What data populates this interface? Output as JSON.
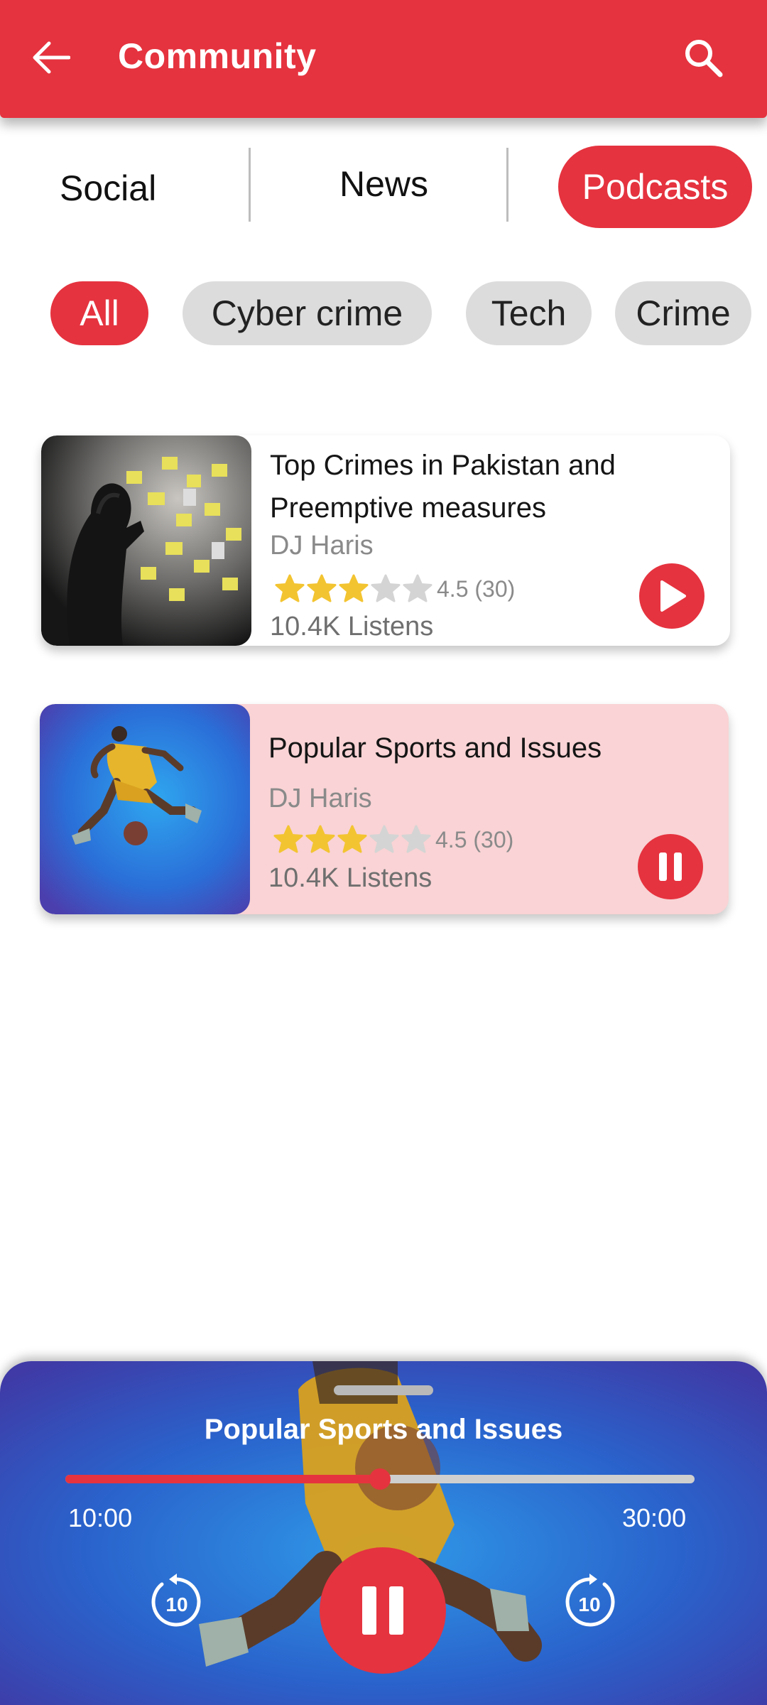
{
  "header": {
    "title": "Community",
    "back_icon": "arrow-left-icon",
    "search_icon": "search-icon",
    "background": "#e5333f"
  },
  "tabs": [
    {
      "label": "Social",
      "active": false
    },
    {
      "label": "News",
      "active": false
    },
    {
      "label": "Podcasts",
      "active": true
    }
  ],
  "filters": [
    {
      "label": "All",
      "active": true
    },
    {
      "label": "Cyber crime",
      "active": false
    },
    {
      "label": "Tech",
      "active": false
    },
    {
      "label": "Crime",
      "active": false
    }
  ],
  "podcasts": [
    {
      "title": "Top Crimes in Pakistan and Preemptive measures",
      "author": "DJ Haris",
      "rating_stars": 3,
      "rating_text": "4.5 (30)",
      "listens": "10.4K Listens",
      "action_icon": "play-icon",
      "playing": false
    },
    {
      "title": "Popular Sports and Issues",
      "author": "DJ Haris",
      "rating_stars": 3,
      "rating_text": "4.5 (30)",
      "listens": "10.4K Listens",
      "action_icon": "pause-icon",
      "playing": true
    }
  ],
  "player": {
    "title": "Popular Sports and Issues",
    "current_time": "10:00",
    "total_time": "30:00",
    "progress": 0.5,
    "rewind_icon": "rewind-10-icon",
    "forward_icon": "forward-10-icon",
    "skip_seconds": "10",
    "main_icon": "pause-icon"
  },
  "colors": {
    "accent": "#e5333f",
    "star_filled": "#f3c431",
    "star_empty": "#d4d4d4",
    "playing_card": "#f9d3d5"
  }
}
